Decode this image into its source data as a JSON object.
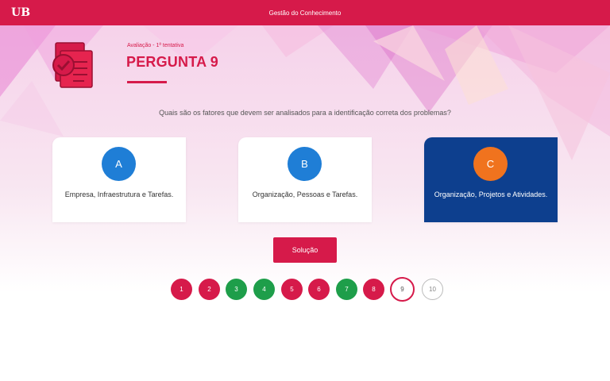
{
  "app": {
    "logo_text": "UB",
    "title": "Gestão do Conhecimento"
  },
  "header": {
    "attempt": "Avaliação - 1ª tentativa",
    "question_title": "PERGUNTA 9"
  },
  "question": {
    "text": "Quais são os fatores que devem ser analisados para a identificação correta dos problemas?"
  },
  "options": [
    {
      "letter": "A",
      "text": "Empresa, Infraestrutura e Tarefas.",
      "selected": false
    },
    {
      "letter": "B",
      "text": "Organização, Pessoas e Tarefas.",
      "selected": false
    },
    {
      "letter": "C",
      "text": "Organização, Projetos e Atividades.",
      "selected": true
    }
  ],
  "solution_button": {
    "label": "Solução"
  },
  "pagination": {
    "pages": [
      {
        "label": "1",
        "status": "wrong"
      },
      {
        "label": "2",
        "status": "wrong"
      },
      {
        "label": "3",
        "status": "correct"
      },
      {
        "label": "4",
        "status": "correct"
      },
      {
        "label": "5",
        "status": "wrong"
      },
      {
        "label": "6",
        "status": "wrong"
      },
      {
        "label": "7",
        "status": "correct"
      },
      {
        "label": "8",
        "status": "wrong"
      },
      {
        "label": "9",
        "status": "current"
      },
      {
        "label": "10",
        "status": "pending"
      }
    ]
  },
  "colors": {
    "primary": "#d61a4a",
    "correct": "#1e9e4a",
    "selected_option_bg": "#0d3f8e",
    "option_a": "#1f7ed6",
    "option_b": "#1f7ed6",
    "option_c": "#f0731e"
  }
}
